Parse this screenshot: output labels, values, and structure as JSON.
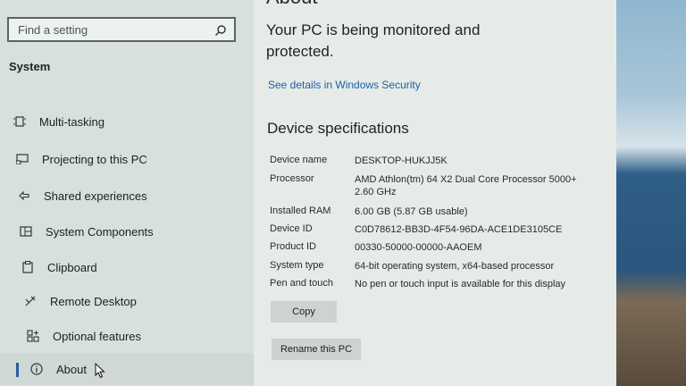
{
  "search": {
    "placeholder": "Find a setting"
  },
  "sidebar": {
    "heading": "System",
    "items": [
      {
        "label": "Multi-tasking",
        "icon": "multitasking-icon"
      },
      {
        "label": "Projecting to this PC",
        "icon": "projecting-icon"
      },
      {
        "label": "Shared experiences",
        "icon": "shared-experiences-icon"
      },
      {
        "label": "System Components",
        "icon": "system-components-icon"
      },
      {
        "label": "Clipboard",
        "icon": "clipboard-icon"
      },
      {
        "label": "Remote Desktop",
        "icon": "remote-desktop-icon"
      },
      {
        "label": "Optional features",
        "icon": "optional-features-icon"
      },
      {
        "label": "About",
        "icon": "info-icon",
        "selected": true
      }
    ]
  },
  "main": {
    "page_title": "About",
    "security_status": "Your PC is being monitored and protected.",
    "security_link": "See details in Windows Security",
    "device_specs_title": "Device specifications",
    "specs": [
      {
        "label": "Device name",
        "value": "DESKTOP-HUKJJ5K"
      },
      {
        "label": "Processor",
        "value": "AMD Athlon(tm) 64 X2 Dual Core Processor 5000+ 2.60 GHz"
      },
      {
        "label": "Installed RAM",
        "value": "6.00 GB (5.87 GB usable)"
      },
      {
        "label": "Device ID",
        "value": "C0D78612-BB3D-4F54-96DA-ACE1DE3105CE"
      },
      {
        "label": "Product ID",
        "value": "00330-50000-00000-AAOEM"
      },
      {
        "label": "System type",
        "value": "64-bit operating system, x64-based processor"
      },
      {
        "label": "Pen and touch",
        "value": "No pen or touch input is available for this display"
      }
    ],
    "copy_button": "Copy",
    "rename_button": "Rename this PC"
  },
  "colors": {
    "accent": "#2c5d9e",
    "link": "#1f5fa8",
    "sidebar_bg": "#d7e0dc",
    "main_bg": "#e6ebe8"
  }
}
